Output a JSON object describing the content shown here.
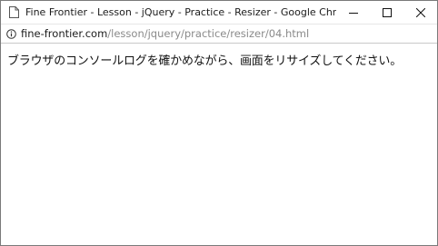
{
  "window": {
    "title": "Fine Frontier - Lesson - jQuery - Practice - Resizer - Google Chrome",
    "controls": {
      "minimize_icon": "minimize-icon",
      "maximize_icon": "maximize-icon",
      "close_icon": "close-icon"
    }
  },
  "address": {
    "icon": "info-icon",
    "host": "fine-frontier.com",
    "path": "/lesson/jquery/practice/resizer/04.html"
  },
  "page": {
    "message": "ブラウザのコンソールログを確かめながら、画面をリサイズしてください。"
  },
  "colors": {
    "border": "#7a7a7a",
    "text": "#111111",
    "url_path": "#8a8a8a"
  }
}
